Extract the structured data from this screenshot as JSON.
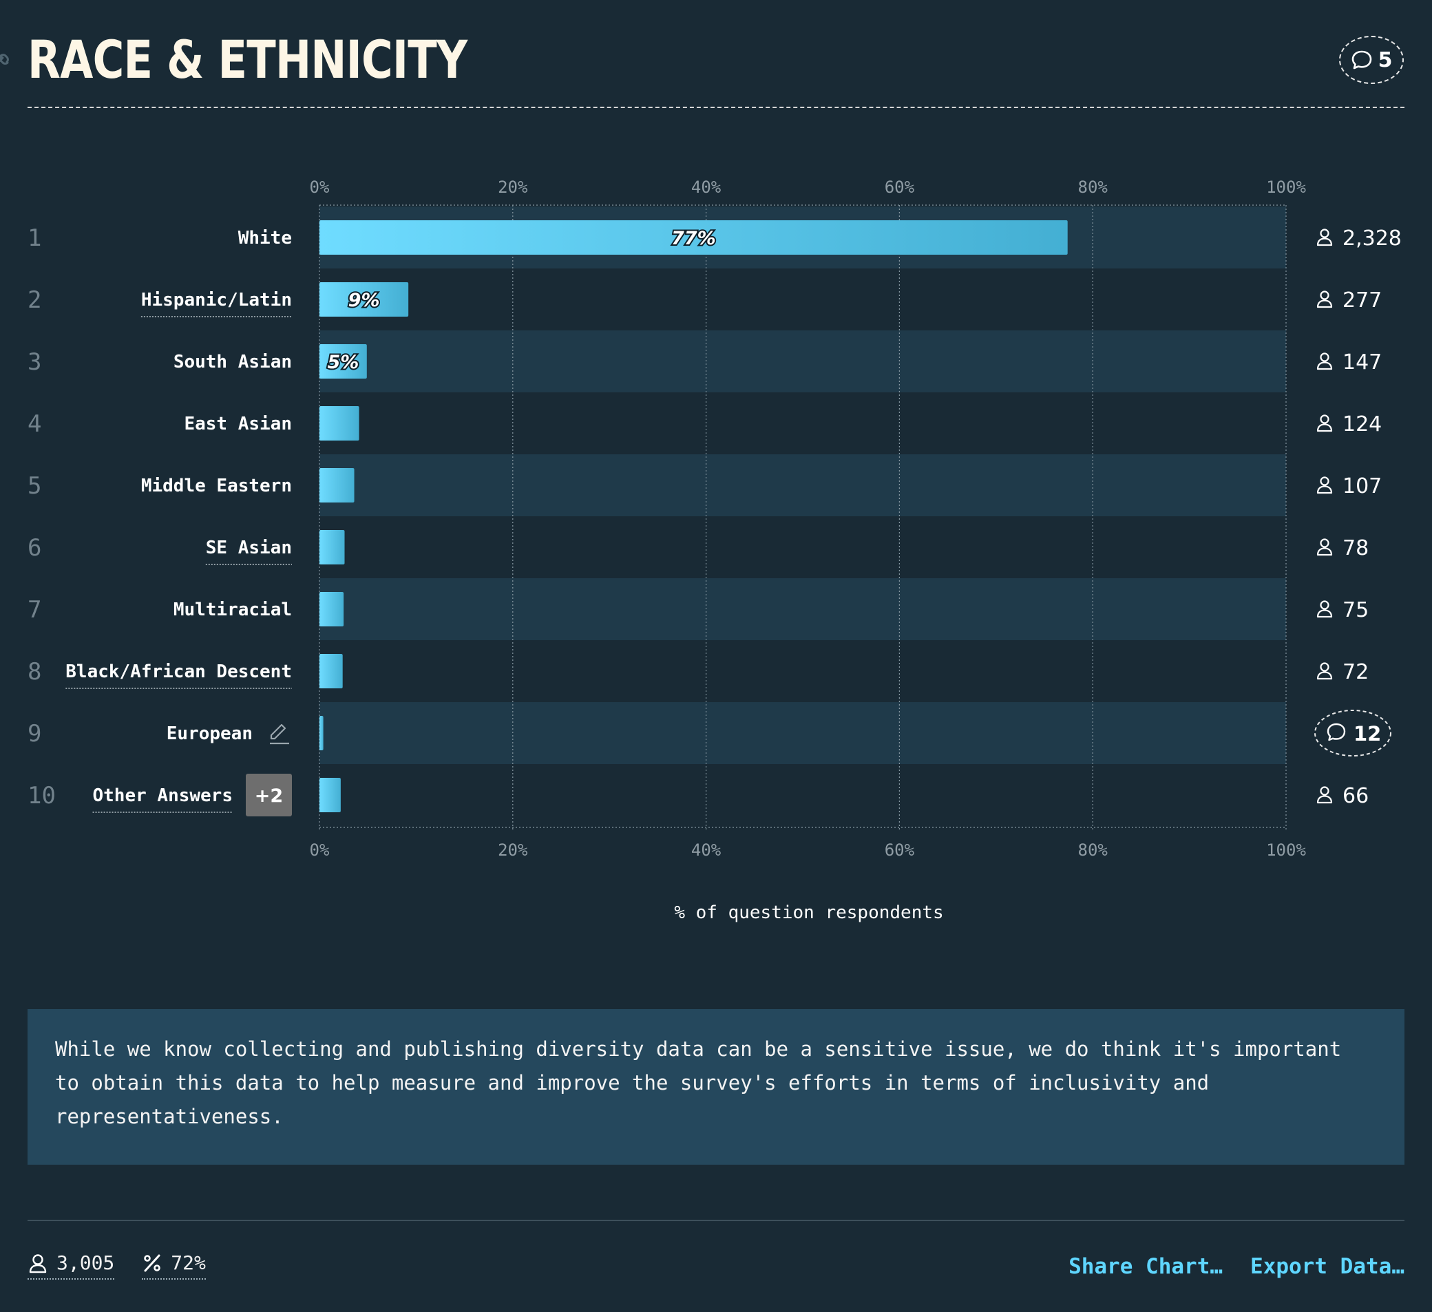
{
  "header": {
    "title": "RACE & ETHNICITY",
    "comment_count": "5"
  },
  "chart_data": {
    "type": "bar",
    "orientation": "horizontal",
    "xlabel": "% of question respondents",
    "xlim": [
      0,
      100
    ],
    "ticks": [
      "0%",
      "20%",
      "40%",
      "60%",
      "80%",
      "100%"
    ],
    "grid": true,
    "rows": [
      {
        "rank": "1",
        "label": "White",
        "value": 77.4,
        "value_label": "77%",
        "count": "2,328",
        "underline": false
      },
      {
        "rank": "2",
        "label": "Hispanic/Latin",
        "value": 9.2,
        "value_label": "9%",
        "count": "277",
        "underline": true
      },
      {
        "rank": "3",
        "label": "South Asian",
        "value": 4.9,
        "value_label": "5%",
        "count": "147",
        "underline": false
      },
      {
        "rank": "4",
        "label": "East Asian",
        "value": 4.1,
        "value_label": "",
        "count": "124",
        "underline": false
      },
      {
        "rank": "5",
        "label": "Middle Eastern",
        "value": 3.6,
        "value_label": "",
        "count": "107",
        "underline": false
      },
      {
        "rank": "6",
        "label": "SE Asian",
        "value": 2.6,
        "value_label": "",
        "count": "78",
        "underline": true
      },
      {
        "rank": "7",
        "label": "Multiracial",
        "value": 2.5,
        "value_label": "",
        "count": "75",
        "underline": false
      },
      {
        "rank": "8",
        "label": "Black/African Descent",
        "value": 2.4,
        "value_label": "",
        "count": "72",
        "underline": true
      },
      {
        "rank": "9",
        "label": "European",
        "value": 0.4,
        "value_label": "",
        "count": "",
        "comments": "12",
        "editable": true,
        "underline": false
      },
      {
        "rank": "10",
        "label": "Other Answers",
        "value": 2.2,
        "value_label": "",
        "count": "66",
        "badge": "+2",
        "underline": true
      }
    ],
    "colors": {
      "bar_start": "#6fdcff",
      "bar_end": "#44afd3",
      "row_stripe": "#1f3a4a",
      "background": "#192a35"
    }
  },
  "note": "While we know collecting and publishing diversity data can be a sensitive issue, we do think it's important to obtain this data to help measure and improve the survey's efforts in terms of inclusivity and representativeness.",
  "footer": {
    "respondents": "3,005",
    "percent": "72%",
    "share_label": "Share Chart…",
    "export_label": "Export Data…"
  }
}
